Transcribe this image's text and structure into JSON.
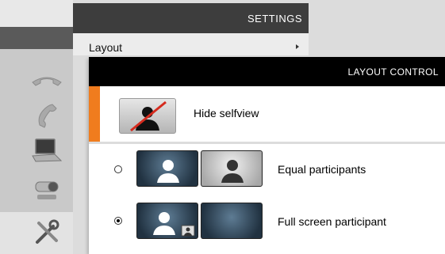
{
  "settings": {
    "title": "SETTINGS",
    "items": [
      {
        "label": "Layout"
      }
    ]
  },
  "layout_control": {
    "title": "LAYOUT CONTROL",
    "selfview": {
      "label": "Hide selfview"
    },
    "options": [
      {
        "label": "Equal participants",
        "selected": false
      },
      {
        "label": "Full screen participant",
        "selected": true
      }
    ]
  },
  "sidebar": {
    "icons": [
      "hangup-phone-icon",
      "phone-handset-icon",
      "laptop-icon",
      "camera-icon",
      "tools-icon"
    ]
  },
  "colors": {
    "accent": "#f07c1e",
    "header_bg": "#000000",
    "settings_header_bg": "#3d3d3d"
  }
}
